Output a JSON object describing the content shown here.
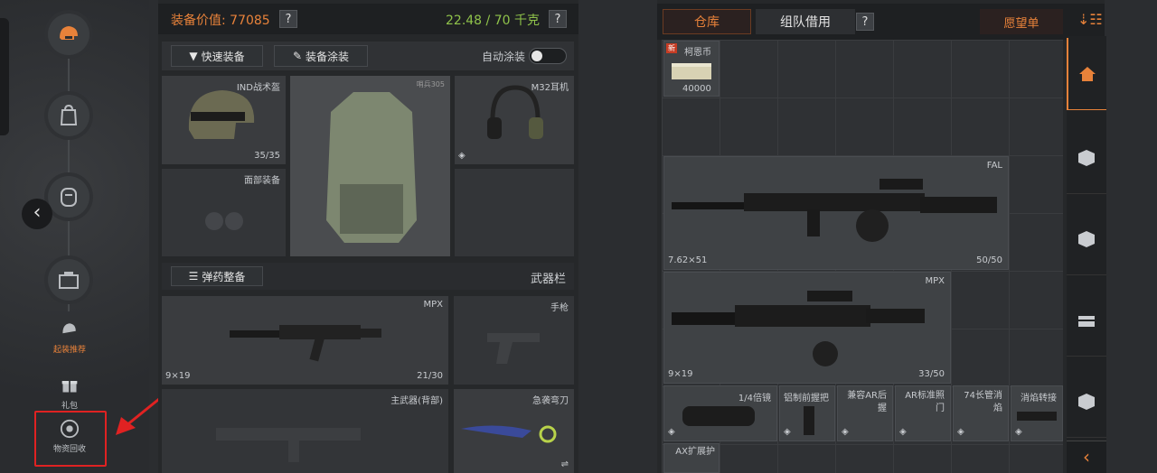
{
  "sidebar": {
    "items": [
      {
        "icon": "helmet-icon"
      },
      {
        "icon": "backpack-icon"
      },
      {
        "icon": "rig-icon"
      },
      {
        "icon": "box-icon"
      }
    ],
    "recommend_label": "起装推荐",
    "gift_label": "礼包",
    "recycle_label": "物资回收",
    "back_glyph": "‹"
  },
  "equip": {
    "value_label": "装备价值: 77085",
    "weight_label": "22.48 / 70 千克",
    "help": "?",
    "quick_equip": "快速装备",
    "paint": "装备涂装",
    "auto_paint": "自动涂装",
    "helmet": {
      "name": "IND战术盔",
      "durability": "35/35"
    },
    "armor": {
      "name": "哨兵305"
    },
    "headset": {
      "name": "M32耳机"
    },
    "face": {
      "name": "面部装备"
    },
    "ammo_btn": "弹药整备",
    "weapon_bar": "武器栏",
    "primary": {
      "name": "MPX",
      "caliber": "9×19",
      "ammo": "21/30"
    },
    "pistol": {
      "name": "手枪"
    },
    "main_back": {
      "name": "主武器(背部)"
    },
    "knife": {
      "name": "急袭弯刀"
    }
  },
  "storage": {
    "tab_warehouse": "仓库",
    "tab_team": "组队借用",
    "help": "?",
    "wishlist": "愿望单",
    "coin": {
      "new": "新",
      "name": "柯恩币",
      "count": "40000"
    },
    "fal": {
      "name": "FAL",
      "caliber": "7.62×51",
      "ammo": "50/50"
    },
    "mpx": {
      "name": "MPX",
      "caliber": "9×19",
      "ammo": "33/50"
    },
    "attachments": [
      "1/4倍镜",
      "铝制前握把",
      "兼容AR后握",
      "AR标准照门",
      "74长管消焰",
      "消焰转接"
    ],
    "ax_ext": "AX扩展护"
  },
  "nav": [
    "home-icon",
    "box-icon",
    "box-icon",
    "chest-icon",
    "box-icon"
  ],
  "colors": {
    "accent": "#e8823a",
    "weight": "#8fc24a",
    "highlight": "#e02222"
  }
}
